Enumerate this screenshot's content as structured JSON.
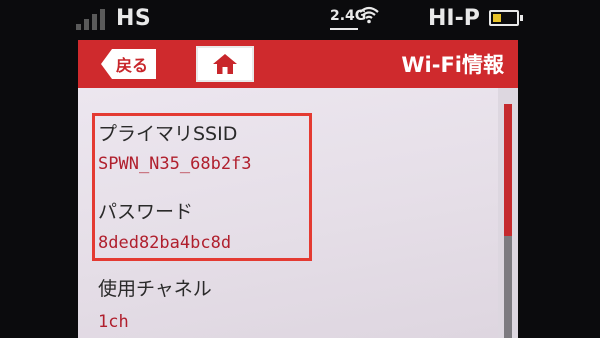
{
  "status_bar": {
    "network": "HS",
    "band": "2.4G",
    "mode": "HI-P",
    "signal_bars": 4,
    "signal_active": 0,
    "battery_level": 0.35,
    "battery_color": "#e8c32a"
  },
  "header": {
    "back_label": "戻る",
    "title": "Wi-Fi情報",
    "color": "#cf2a2d"
  },
  "info": {
    "ssid_label": "プライマリSSID",
    "ssid_value": "SPWN_N35_68b2f3",
    "password_label": "パスワード",
    "password_value": "8ded82ba4bc8d",
    "channel_label": "使用チャネル",
    "channel_value": "1ch"
  },
  "icons": {
    "back": "arrow-left-icon",
    "home": "home-icon",
    "wifi": "wifi-icon",
    "battery": "battery-icon",
    "signal": "signal-icon"
  }
}
